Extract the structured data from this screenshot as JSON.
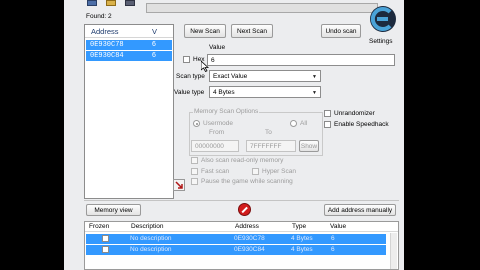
{
  "found_label": "Found: 2",
  "address_list": {
    "header_address": "Address",
    "header_value": "V",
    "rows": [
      {
        "address": "0E930C78",
        "value": "6"
      },
      {
        "address": "0E930C84",
        "value": "6"
      }
    ]
  },
  "buttons": {
    "new_scan": "New Scan",
    "next_scan": "Next Scan",
    "undo_scan": "Undo scan",
    "memory_view": "Memory view",
    "add_address": "Add address manually",
    "show": "Show"
  },
  "settings_label": "Settings",
  "value_label": "Value",
  "hex_label": "Hex",
  "value_input": "6",
  "scan_type_label": "Scan type",
  "scan_type_value": "Exact Value",
  "value_type_label": "Value type",
  "value_type_value": "4 Bytes",
  "memory_scan": {
    "title": "Memory Scan Options",
    "usermode": "Usermode",
    "all": "All",
    "from_label": "From",
    "to_label": "To",
    "from_value": "00000000",
    "to_value": "7FFFFFFF"
  },
  "options": {
    "readonly": "Also scan read-only memory",
    "fast_scan": "Fast scan",
    "hyper_scan": "Hyper Scan",
    "pause": "Pause the game while scanning",
    "unrandomizer": "Unrandomizer",
    "speedhack": "Enable Speedhack"
  },
  "cheat_table": {
    "headers": [
      "Frozen",
      "Description",
      "Address",
      "Type",
      "Value"
    ],
    "rows": [
      {
        "description": "No description",
        "address": "0E930C78",
        "type": "4 Bytes",
        "value": "6"
      },
      {
        "description": "No description",
        "address": "0E930C84",
        "type": "4 Bytes",
        "value": "6"
      }
    ]
  },
  "colors": {
    "selection": "#3399ff",
    "panel_bg": "#ecedef",
    "stop_red": "#d21c1c"
  }
}
